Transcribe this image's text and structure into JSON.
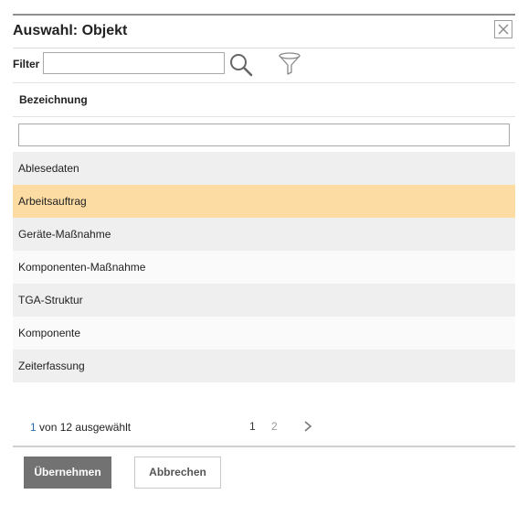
{
  "dialog": {
    "title": "Auswahl: Objekt"
  },
  "filter": {
    "label": "Filter",
    "value": ""
  },
  "table": {
    "column_header": "Bezeichnung",
    "column_filter_value": "",
    "rows": [
      {
        "label": "Ablesedaten",
        "selected": false
      },
      {
        "label": "Arbeitsauftrag",
        "selected": true
      },
      {
        "label": "Geräte-Maßnahme",
        "selected": false
      },
      {
        "label": "Komponenten-Maßnahme",
        "selected": false
      },
      {
        "label": "TGA-Struktur",
        "selected": false
      },
      {
        "label": "Komponente",
        "selected": false
      },
      {
        "label": "Zeiterfassung",
        "selected": false
      }
    ]
  },
  "footer": {
    "selected_count": "1",
    "selected_suffix": "von 12 ausgewählt",
    "pages": [
      "1",
      "2"
    ],
    "current_page": "1"
  },
  "buttons": {
    "apply": "Übernehmen",
    "cancel": "Abbrechen"
  },
  "colors": {
    "selected_row": "#fcdca3",
    "row_odd": "#efefef",
    "row_even": "#fafafa",
    "primary_button": "#727272",
    "count_highlight": "#2b6cb0"
  }
}
